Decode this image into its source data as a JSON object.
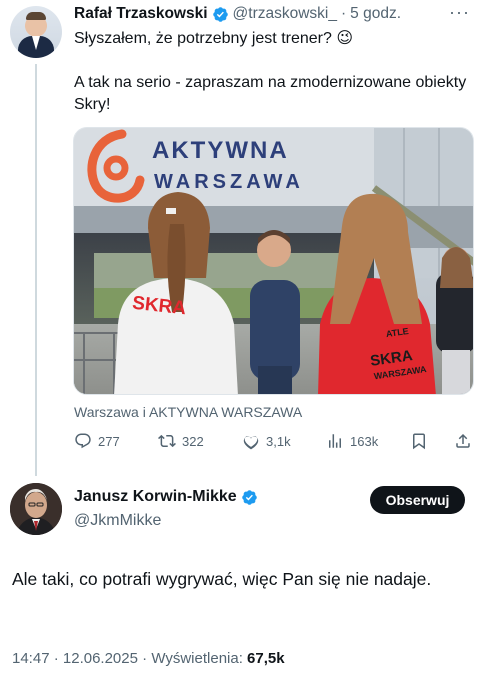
{
  "parent_tweet": {
    "author_name": "Rafał Trzaskowski",
    "handle": "@trzaskowski_",
    "separator": "·",
    "time": "5 godz.",
    "more": "···",
    "text_lines": [
      "Słyszałem, że potrzebny jest trener? 😉",
      "A tak na serio - zapraszam na zmodernizowane obiekty Skry!"
    ],
    "photo": {
      "sign_line1": "AKTYWNA",
      "sign_line2": "WARSZAWA",
      "shirt_text_left": "SKRA",
      "shirt_text_right": "SKRA",
      "shirt_sub_right": "WARSZAWA",
      "shirt_small_right": "ATLE"
    },
    "source": "Warszawa i AKTYWNA WARSZAWA",
    "actions": {
      "replies": "277",
      "reposts": "322",
      "likes": "3,1k",
      "views": "163k"
    }
  },
  "reply_tweet": {
    "author_name": "Janusz Korwin-Mikke",
    "handle": "@JkmMikke",
    "follow_label": "Obserwuj",
    "text": "Ale taki, co potrafi wygrywać, więc Pan się nie nadaje.",
    "time": "14:47",
    "dot": "·",
    "date": "12.06.2025",
    "views_label": "Wyświetlenia:",
    "views_count": "67,5k"
  },
  "colors": {
    "verified_blue": "#1d9bf0",
    "text_secondary": "#536471",
    "skra_red": "#e0282e"
  }
}
